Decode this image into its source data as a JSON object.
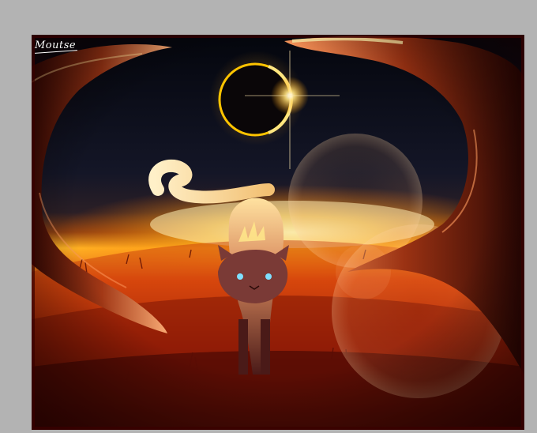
{
  "artwork": {
    "signature": "Moutse",
    "colors": {
      "background_frame": "#b3b3b3",
      "sky_top": "#05070f",
      "sky_mid": "#1c1a2c",
      "horizon_glow": "#ffb21a",
      "ground": "#c2310a",
      "ground_dark": "#3a0402",
      "tree_bark": "#8a2a10",
      "eclipse_ring": "#ffc400"
    },
    "icons": [
      "eclipse-sun",
      "lens-flare",
      "cat-figure",
      "tree-branch"
    ]
  }
}
